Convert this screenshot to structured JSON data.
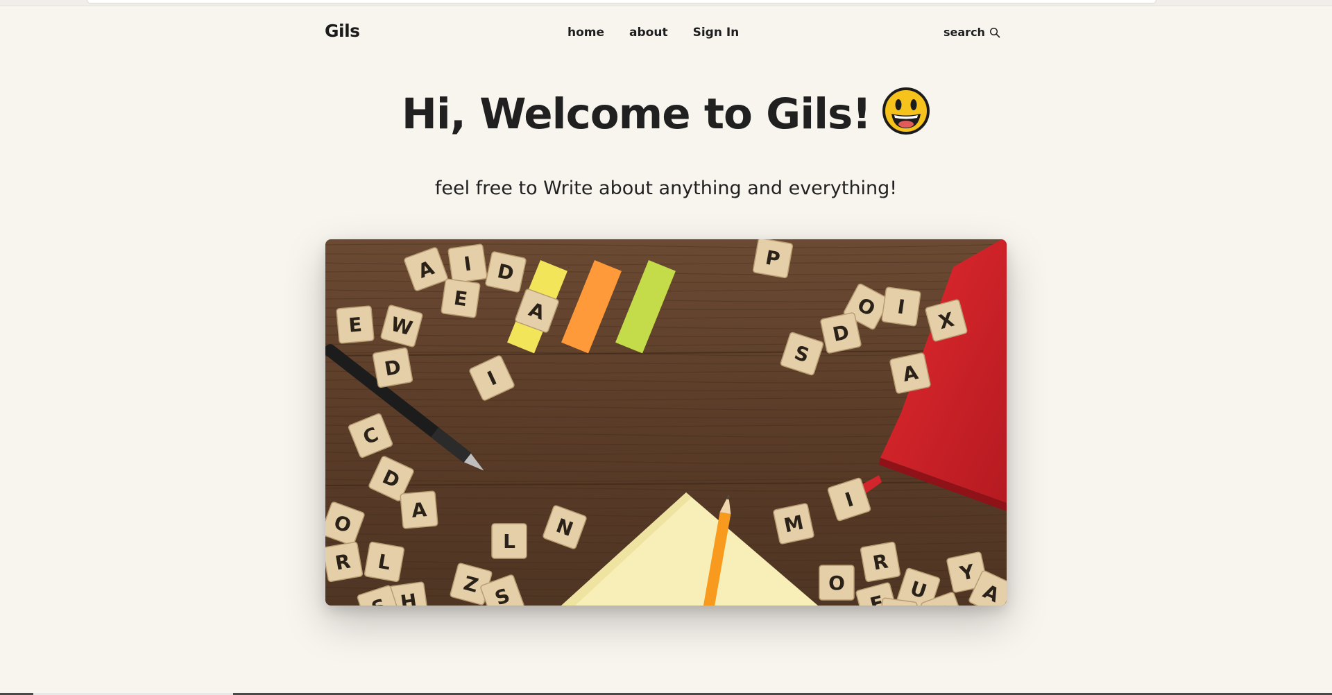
{
  "brand": "Gils",
  "nav": {
    "links": [
      "home",
      "about",
      "Sign In"
    ],
    "search_label": "search"
  },
  "hero": {
    "title": "Hi, Welcome to Gils!",
    "emoji_icon": "grinning-face-icon",
    "subtitle": "feel free to Write about anything and everything!"
  },
  "image_tiles": [
    "A",
    "I",
    "D",
    "E",
    "W",
    "E",
    "A",
    "D",
    "I",
    "P",
    "O",
    "S",
    "D",
    "I",
    "X",
    "A",
    "C",
    "D",
    "O",
    "A",
    "R",
    "L",
    "H",
    "S",
    "Z",
    "S",
    "L",
    "N",
    "M",
    "I",
    "R",
    "O",
    "E",
    "U",
    "Y",
    "E",
    "A",
    "E"
  ],
  "colors": {
    "background": "#f8f4ee",
    "text": "#1f1f1f",
    "wood": "#5a3b26",
    "tile": "#e4cfa8",
    "book": "#d1262b",
    "sticky_yellow": "#f2e55a",
    "sticky_orange": "#ff9a3a",
    "sticky_green": "#c4dc4a"
  }
}
